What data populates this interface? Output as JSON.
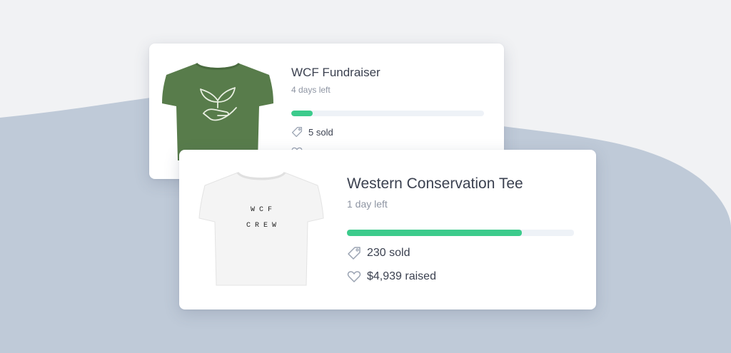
{
  "cards": [
    {
      "title": "WCF Fundraiser",
      "time_left": "4 days left",
      "progress_fraction": 0.11,
      "sold": "5 sold",
      "raised": "",
      "shirt_color": "#587c4b",
      "shirt_print": [
        "",
        ""
      ]
    },
    {
      "title": "Western Conservation Tee",
      "time_left": "1 day left",
      "progress_fraction": 0.77,
      "sold": "230 sold",
      "raised": "$4,939 raised",
      "shirt_color": "#f4f4f4",
      "shirt_print": [
        "W C F",
        "C R E W"
      ]
    }
  ],
  "colors": {
    "progress_fill": "#3ccb8c",
    "progress_track": "#eef2f7",
    "background_blob": "#bfcad8",
    "background": "#f1f2f4"
  },
  "icons": [
    "tag-icon",
    "heart-icon",
    "leaf-hand-icon"
  ]
}
